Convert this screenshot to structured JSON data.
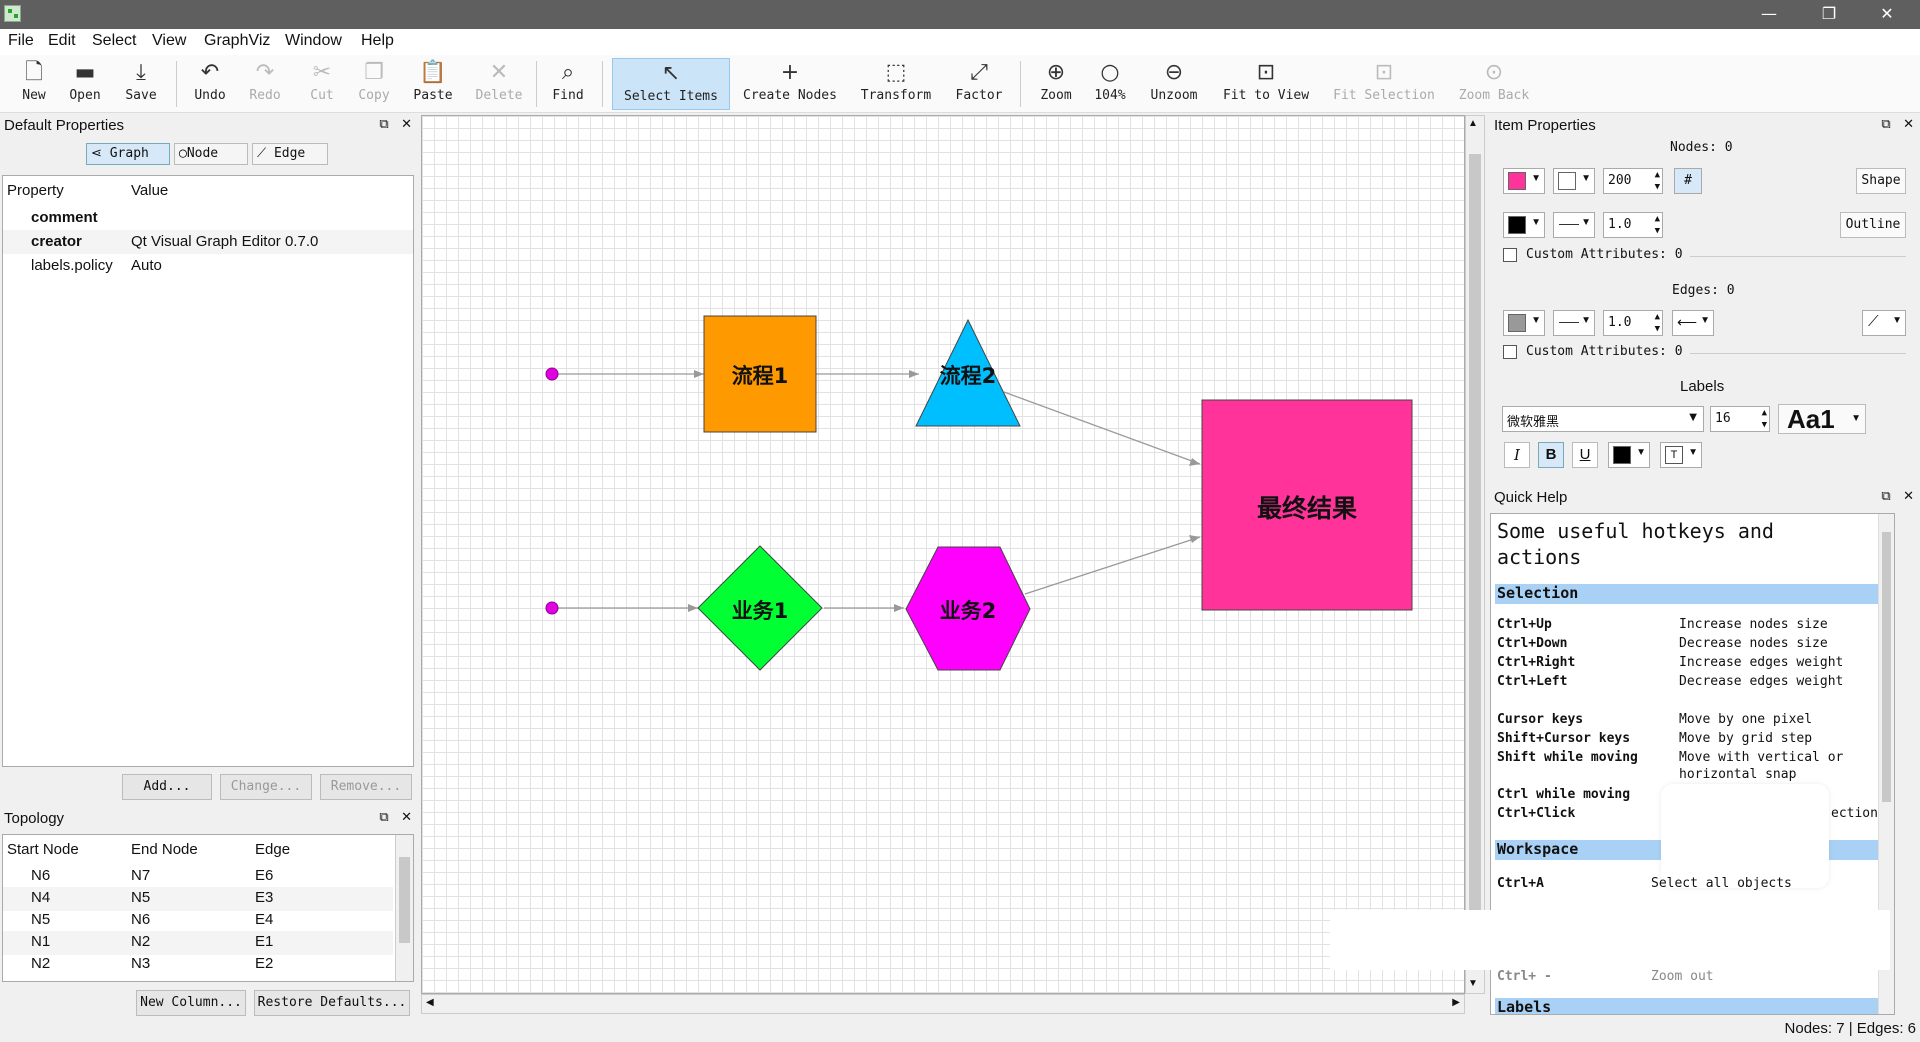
{
  "window": {
    "min": "—",
    "max": "❐",
    "close": "✕"
  },
  "menu": [
    "File",
    "Edit",
    "Select",
    "View",
    "GraphViz",
    "Window",
    "Help"
  ],
  "toolbar": {
    "new": "New",
    "open": "Open",
    "save": "Save",
    "undo": "Undo",
    "redo": "Redo",
    "cut": "Cut",
    "copy": "Copy",
    "paste": "Paste",
    "delete": "Delete",
    "find": "Find",
    "select": "Select Items",
    "create": "Create Nodes",
    "transform": "Transform",
    "factor": "Factor",
    "zoom": "Zoom",
    "zoomval": "104%",
    "unzoom": "Unzoom",
    "fit": "Fit to View",
    "fitsel": "Fit Selection",
    "zoomback": "Zoom Back"
  },
  "defaults": {
    "title": "Default Properties",
    "tabs": [
      "Graph",
      "Node",
      "Edge"
    ],
    "headers": [
      "Property",
      "Value"
    ],
    "rows": [
      [
        "comment",
        ""
      ],
      [
        "creator",
        "Qt Visual Graph Editor 0.7.0"
      ],
      [
        "labels.policy",
        "Auto"
      ]
    ],
    "buttons": [
      "Add...",
      "Change...",
      "Remove..."
    ]
  },
  "topology": {
    "title": "Topology",
    "headers": [
      "Start Node",
      "End Node",
      "Edge"
    ],
    "rows": [
      [
        "N6",
        "N7",
        "E6"
      ],
      [
        "N4",
        "N5",
        "E3"
      ],
      [
        "N5",
        "N6",
        "E4"
      ],
      [
        "N1",
        "N2",
        "E1"
      ],
      [
        "N2",
        "N3",
        "E2"
      ]
    ],
    "buttons": [
      "New Column...",
      "Restore Defaults..."
    ]
  },
  "graph": {
    "nodes": [
      "流程1",
      "流程2",
      "最终结果",
      "业务1",
      "业务2"
    ]
  },
  "item": {
    "title": "Item Properties",
    "nodes": "Nodes: 0",
    "edges": "Edges: 0",
    "size": "200",
    "width": "1.0",
    "ewidth": "1.0",
    "shape": "Shape",
    "outline": "Outline",
    "hash": "#",
    "custom1": "Custom Attributes: 0",
    "custom2": "Custom Attributes: 0",
    "labels": "Labels",
    "font": "微软雅黑",
    "fontsize": "16",
    "aa": "Aa1",
    "italic": "I",
    "bold": "B",
    "underline": "U",
    "colors": {
      "node": "#ff3399",
      "edge": "#999999"
    }
  },
  "quickhelp": {
    "title": "Quick Help",
    "heading": "Some useful hotkeys and actions",
    "sections": [
      "Selection",
      "Workspace",
      "Labels"
    ],
    "keys": [
      [
        "Ctrl+Up",
        "Increase nodes size"
      ],
      [
        "Ctrl+Down",
        "Decrease nodes size"
      ],
      [
        "Ctrl+Right",
        "Increase edges weight"
      ],
      [
        "Ctrl+Left",
        "Decrease edges weight"
      ],
      [
        "Cursor keys",
        "Move by one pixel"
      ],
      [
        "Shift+Cursor keys",
        "Move by grid step"
      ],
      [
        "Shift while moving",
        "Move with vertical or"
      ],
      [
        "",
        "horizontal snap"
      ],
      [
        "Ctrl while moving",
        ""
      ],
      [
        "Ctrl+Click",
        "ection"
      ]
    ],
    "ws": [
      [
        "Ctrl+A",
        "Select all objects"
      ],
      [
        "Ctrl+ -",
        "Zoom out"
      ]
    ]
  },
  "status": "Nodes: 7 | Edges: 6"
}
